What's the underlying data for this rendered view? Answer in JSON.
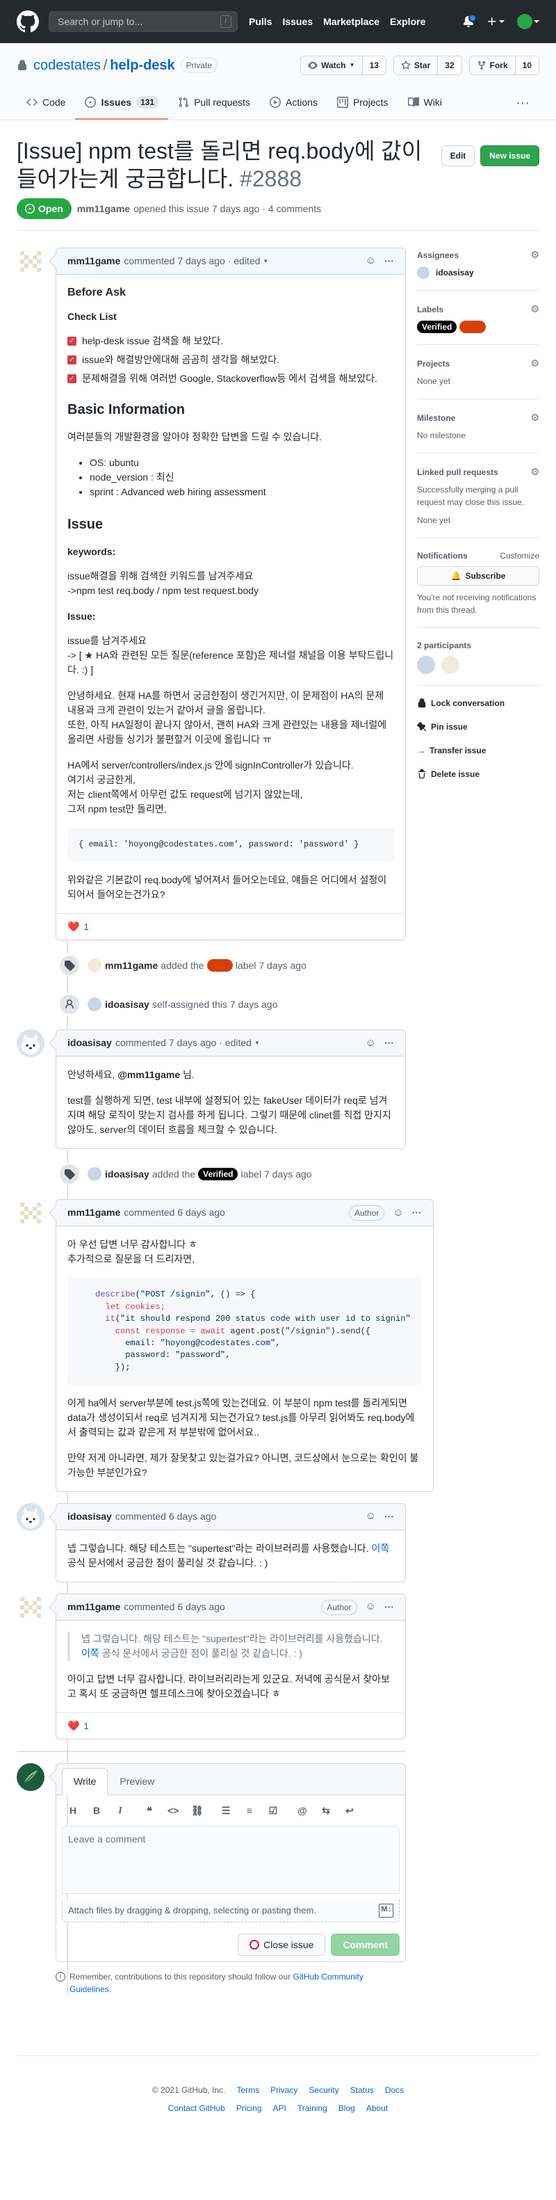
{
  "header": {
    "search_placeholder": "Search or jump to...",
    "search_key": "/",
    "nav": [
      "Pulls",
      "Issues",
      "Marketplace",
      "Explore"
    ]
  },
  "repo": {
    "owner": "codestates",
    "sep": "/",
    "name": "help-desk",
    "visibility": "Private",
    "watch_label": "Watch",
    "watch_count": "13",
    "star_label": "Star",
    "star_count": "32",
    "fork_label": "Fork",
    "fork_count": "10",
    "tabs": [
      {
        "label": "Code",
        "count": ""
      },
      {
        "label": "Issues",
        "count": "131"
      },
      {
        "label": "Pull requests",
        "count": ""
      },
      {
        "label": "Actions",
        "count": ""
      },
      {
        "label": "Projects",
        "count": ""
      },
      {
        "label": "Wiki",
        "count": ""
      }
    ],
    "more": "···"
  },
  "issue": {
    "title": "[Issue] npm test를 돌리면 req.body에 값이 들어가는게 궁금합니다.",
    "number": "#2888",
    "edit_label": "Edit",
    "new_issue_label": "New issue",
    "state": "Open",
    "author": "mm11game",
    "meta": "opened this issue 7 days ago · 4 comments"
  },
  "comment1": {
    "author": "mm11game",
    "meta": "commented 7 days ago · edited",
    "h_before": "Before Ask",
    "checklist_title": "Check List",
    "checklist": [
      "help-desk issue 검색을 해 보았다.",
      "issue와 해결방안에대해 곰곰히 생각을 해보았다.",
      "문제해결을 위해 여러번 Google, Stackoverflow등 에서 검색을 해보았다."
    ],
    "h_basic": "Basic Information",
    "basic_intro": "여러분들의 개발환경을 알아야 정확한 답변을 드릴 수 있습니다.",
    "basic_list": [
      "OS: ubuntu",
      "node_version : 최신",
      "sprint : Advanced web hiring assessment"
    ],
    "h_issue": "Issue",
    "keywords_label": "keywords:",
    "keywords_1": "issue해결을 위해 검색한 키워드를 남겨주세요",
    "keywords_2": "->npm test req.body / npm test request.body",
    "issue_label": "Issue:",
    "issue_1": "issue를 남겨주세요",
    "issue_2": "-> [ ★ HA와 관련된 모든 질문(reference 포함)은 제너럴 채널을 이용 부탁드립니다. :) ]",
    "para_1": "안녕하세요. 현재 HA를 하면서 궁금한점이 생긴거지만, 이 문제점이 HA의 문제 내용과 크게 관련이 있는거 같아서 글을 올립니다.",
    "para_2": "또한, 아직 HA일정이 끝나지 않아서, 괜히 HA와 크게 관련있는 내용을 제너럴에 올리면 사람들 싱기가 불편할거 이곳에 올립니다 ㅠ",
    "para_3a": "HA에서 server/controllers/index.js 안에 signInController가 있습니다.",
    "para_3b": "여기서 궁금한게,",
    "para_3c": "저는 client쪽에서 아무런 값도 request에 넘기지 않았는데,",
    "para_3d": "그저 npm test만 돌리면,",
    "code": "{ email: 'hoyong@codestates.com', password: 'password' }",
    "para_4": "위와같은 기본값이 req.body에 넣어져서 들어오는데요, 얘들은 어디에서 설정이 되어서 들어오는건가요?",
    "reaction": "❤️",
    "reaction_count": "1"
  },
  "event1": {
    "actor": "mm11game",
    "pre": "added the",
    "post": "label 7 days ago"
  },
  "event2": {
    "actor": "idoasisay",
    "text": "self-assigned this 7 days ago"
  },
  "comment2": {
    "author": "idoasisay",
    "meta": "commented 7 days ago · edited",
    "greet": "안녕하세요,",
    "mention": "@mm11game",
    "greet_end": "님.",
    "body": "test를 실행하게 되면, test 내부에 설정되어 있는 fakeUser 데이터가 req로 넘겨지며 해당 로직이 맞는지 검사를 하게 됩니다. 그렇기 때문에 clinet를 직접 만지지 않아도, server의 데이터 흐름을 체크할 수 있습니다."
  },
  "event3": {
    "actor": "idoasisay",
    "pre": "added the",
    "label": "Verified",
    "post": "label 7 days ago"
  },
  "comment3": {
    "author": "mm11game",
    "meta": "commented 6 days ago",
    "role": "Author",
    "line1": "아 우선 답변 너무 감사합니다 ㅎ",
    "line2": "추가적으로 질문을 더 드리자면,",
    "code_l1_kw": "describe",
    "code_l1_s": "\"POST /signin\"",
    "code_l1_end": ", () => {",
    "code_l2": "  let cookies;",
    "code_l3_f": "  it",
    "code_l3_s": "(\"it should respond 200 status code with user id to signin\"",
    "code_l4_a": "    const response = ",
    "code_l4_b": "await",
    "code_l4_c": " agent.post(\"/signin\").send({",
    "code_l5": "      email: \"hoyong@codestates.com\",",
    "code_l6": "      password: \"password\",",
    "code_l7": "    });",
    "para_1": "이게 ha에서 server부분에 test.js쪽에 있는건데요. 이 부분이 npm test를 돌리게되면 data가 생성이되서 req로 넘겨지게 되는건가요? test.js를 아무리 읽어봐도 req.body에서 출력되는 값과 같은게 저 부분밖에 없어서요..",
    "para_2": "만약 저게 아니라면, 제가 잘못찾고 있는걸가요? 아니면, 코드상에서 눈으로는 확인이 불가능한 부분인가요?"
  },
  "comment4": {
    "author": "idoasisay",
    "meta": "commented 6 days ago",
    "body_a": "넵 그렇습니다. 해당 테스트는 \"supertest\"라는 라이브러리를 사용했습니다.",
    "link": "이쪽",
    "body_b": "공식 문서에서 궁금한 점이 풀리실 것 같습니다. : )"
  },
  "comment5": {
    "author": "mm11game",
    "meta": "commented 6 days ago",
    "role": "Author",
    "quote_a": "넵 그렇습니다. 해당 테스트는 \"supertest\"라는 라이브러리를 사용했습니다.",
    "quote_link": "이쪽",
    "quote_b": "공식 문서에서 궁금한 점이 풀리실 것 같습니다. : )",
    "body": "아이고 답변 너무 감사합니다. 라이브러리라는게 있군요. 저녁에 공식문서 찾아보고 혹시 또 궁금하면 헬프데스크에 찾아오겠습니다 ㅎ",
    "reaction": "❤️",
    "reaction_count": "1"
  },
  "editor": {
    "tab_write": "Write",
    "tab_preview": "Preview",
    "toolbar": [
      "H",
      "B",
      "I"
    ],
    "placeholder": "Leave a comment",
    "attach": "Attach files by dragging & dropping, selecting or pasting them.",
    "md": "M↓",
    "close_label": "Close issue",
    "comment_label": "Comment"
  },
  "reminder": {
    "pre": "Remember, contributions to this repository should follow our",
    "link": "GitHub Community Guidelines",
    "post": "."
  },
  "sidebar": {
    "assignees_title": "Assignees",
    "assignee": "idoasisay",
    "labels_title": "Labels",
    "label_1": "Verified",
    "projects_title": "Projects",
    "projects_value": "None yet",
    "milestone_title": "Milestone",
    "milestone_value": "No milestone",
    "linked_title": "Linked pull requests",
    "linked_desc": "Successfully merging a pull request may close this issue.",
    "linked_value": "None yet",
    "notif_title": "Notifications",
    "customize": "Customize",
    "subscribe": "Subscribe",
    "notif_desc": "You're not receiving notifications from this thread.",
    "participants_title": "2 participants",
    "lock": "Lock conversation",
    "pin": "Pin issue",
    "transfer": "Transfer issue",
    "delete": "Delete issue"
  },
  "footer": {
    "copyright": "© 2021 GitHub, Inc.",
    "row1": [
      "Terms",
      "Privacy",
      "Security",
      "Status",
      "Docs"
    ],
    "row2": [
      "Contact GitHub",
      "Pricing",
      "API",
      "Training",
      "Blog",
      "About"
    ]
  },
  "colors": {
    "accent": "#0366d6",
    "open": "#28a745",
    "header": "#24292e",
    "label_red": "#d93f0b"
  }
}
